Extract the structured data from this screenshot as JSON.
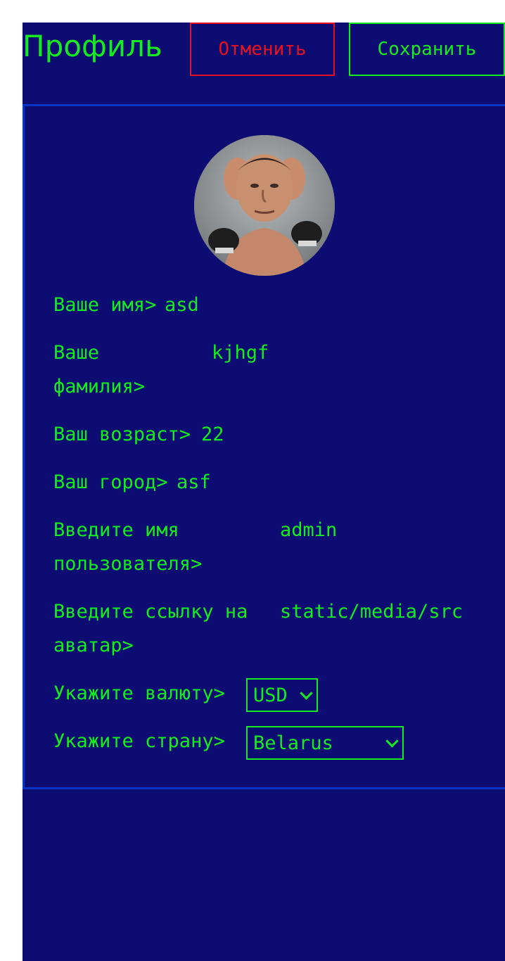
{
  "header": {
    "title": "Профиль",
    "cancel_label": "Отменить",
    "save_label": "Сохранить"
  },
  "profile": {
    "avatar_icon": "avatar-photo",
    "fields": [
      {
        "label": "Ваше имя>",
        "value": "asd"
      },
      {
        "label_line1": "Ваше",
        "label_line2": "фамилия>",
        "value": "kjhgf"
      },
      {
        "label": "Ваш возраст>",
        "value": "22"
      },
      {
        "label": "Ваш город>",
        "value": "asf"
      },
      {
        "label_line1": "Введите имя",
        "label_line2": "пользователя>",
        "value": "admin"
      },
      {
        "label_line1": "Введите ссылку на",
        "label_line2": "аватар>",
        "value": "static/media/src"
      }
    ],
    "currency": {
      "label": "Укажите валюту>",
      "selected": "USD"
    },
    "country": {
      "label": "Укажите страну>",
      "selected": "Belarus"
    }
  },
  "colors": {
    "background": "#0c0c72",
    "text": "#15ec1f",
    "cancel": "#e8101f",
    "card_border": "#0a35c9"
  }
}
